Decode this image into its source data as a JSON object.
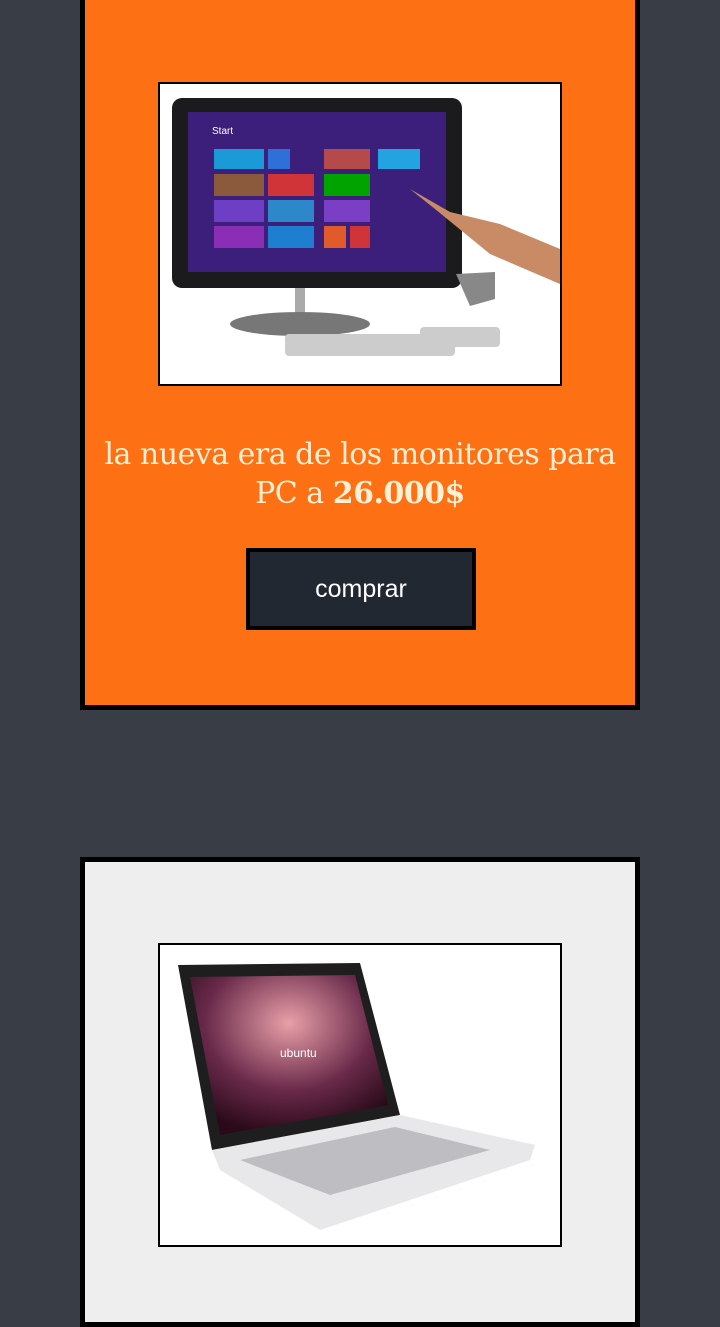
{
  "colors": {
    "page_bg": "#393e46",
    "card1_bg": "#fd7014",
    "card2_bg": "#eeeeee",
    "button_bg": "#222831",
    "title_text": "#fdf0d5"
  },
  "products": [
    {
      "image": "all-in-one touchscreen PC with Windows 8",
      "image_text": "Start",
      "title": "la nueva era de los monitores para PC a ",
      "price": "26.000$",
      "button_label": "comprar"
    },
    {
      "image": "laptop with ubuntu",
      "image_text": "ubuntu"
    }
  ]
}
